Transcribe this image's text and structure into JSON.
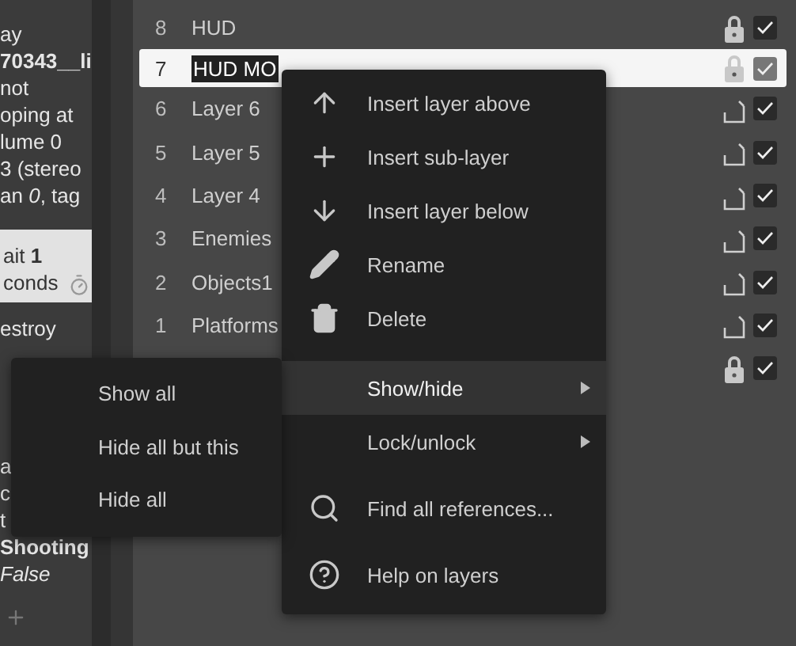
{
  "sidebar": {
    "blocks": [
      {
        "kind": "text",
        "lines": [
          "ay",
          "**70343__li**",
          "not",
          "oping at",
          "lume 0",
          "3 (stereo",
          "an *0*, tag"
        ]
      },
      {
        "kind": "card",
        "lines": [
          "ait **1**",
          "conds"
        ]
      },
      {
        "kind": "text",
        "lines": [
          "estroy"
        ]
      },
      {
        "kind": "gap"
      },
      {
        "kind": "text",
        "lines": [
          "a",
          "c"
        ]
      },
      {
        "kind": "text",
        "lines": [
          "t",
          "**Shooting**",
          "*False*"
        ]
      },
      {
        "kind": "add"
      }
    ]
  },
  "layers": [
    {
      "number": "8",
      "name": "HUD",
      "editing": false,
      "locked": true,
      "visible": true,
      "selected": false
    },
    {
      "number": "7",
      "name": "HUD MO",
      "locked": true,
      "visible": true,
      "selected": true,
      "editing": true
    },
    {
      "number": "6",
      "name": "Layer 6",
      "editing": false,
      "locked": false,
      "visible": true,
      "selected": false
    },
    {
      "number": "5",
      "name": "Layer 5",
      "editing": false,
      "locked": false,
      "visible": true,
      "selected": false
    },
    {
      "number": "4",
      "name": "Layer 4",
      "editing": false,
      "locked": false,
      "visible": true,
      "selected": false
    },
    {
      "number": "3",
      "name": "Enemies",
      "editing": false,
      "locked": false,
      "visible": true,
      "selected": false
    },
    {
      "number": "2",
      "name": "Objects1",
      "editing": false,
      "locked": false,
      "visible": true,
      "selected": false
    },
    {
      "number": "1",
      "name": "Platforms",
      "editing": false,
      "locked": false,
      "visible": true,
      "selected": false
    },
    {
      "locked": true,
      "visible": true,
      "selected": false
    }
  ],
  "context_menu": {
    "items": [
      {
        "kind": "item",
        "label": "Insert layer above"
      },
      {
        "kind": "item",
        "label": "Insert sub-layer"
      },
      {
        "kind": "item",
        "label": "Insert layer below"
      },
      {
        "kind": "item",
        "label": "Rename"
      },
      {
        "kind": "item",
        "label": "Delete"
      },
      {
        "kind": "separator"
      },
      {
        "kind": "submenu",
        "label": "Show/hide",
        "selected": true
      },
      {
        "kind": "submenu",
        "label": "Lock/unlock",
        "selected": false
      },
      {
        "kind": "separator"
      },
      {
        "kind": "item",
        "label": "Find all references..."
      },
      {
        "kind": "separator"
      },
      {
        "kind": "item",
        "label": "Help on layers"
      }
    ]
  },
  "submenu": {
    "items": [
      {
        "label": "Show all"
      },
      {
        "label": "Hide all but this"
      },
      {
        "label": "Hide all"
      }
    ]
  }
}
